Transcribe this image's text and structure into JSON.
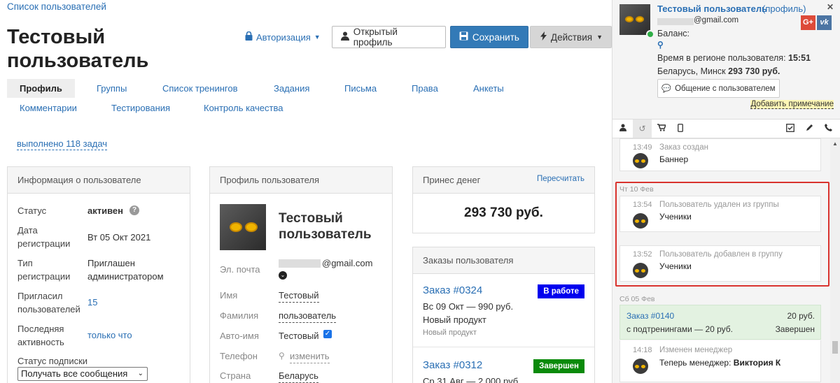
{
  "breadcrumb": "Список пользователей",
  "page_title": "Тестовый пользователь",
  "toolbar": {
    "auth_label": "Авторизация",
    "open_profile_label": "Открытый профиль",
    "save_label": "Сохранить",
    "actions_label": "Действия"
  },
  "tabs": [
    "Профиль",
    "Группы",
    "Список тренингов",
    "Задания",
    "Письма",
    "Права",
    "Анкеты",
    "Комментарии",
    "Тестирования",
    "Контроль качества"
  ],
  "tasks_done": "выполнено 118 задач",
  "info_panel": {
    "title": "Информация о пользователе",
    "status_label": "Статус",
    "status_value": "активен",
    "reg_date_label_1": "Дата",
    "reg_date_label_2": "регистрации",
    "reg_date_value": "Вт 05 Окт 2021",
    "reg_type_label_1": "Тип",
    "reg_type_label_2": "регистрации",
    "reg_type_value_1": "Приглашен",
    "reg_type_value_2": "администратором",
    "invited_label_1": "Пригласил",
    "invited_label_2": "пользователей",
    "invited_value": "15",
    "last_active_label_1": "Последняя",
    "last_active_label_2": "активность",
    "last_active_value": "только что",
    "sub_status_label": "Статус подписки",
    "sub_status_value": "Получать все сообщения"
  },
  "profile_panel": {
    "title": "Профиль пользователя",
    "name_1": "Тестовый",
    "name_2": "пользователь",
    "email_label": "Эл. почта",
    "email_value": "@gmail.com",
    "first_name_label": "Имя",
    "first_name_value": "Тестовый",
    "last_name_label": "Фамилия",
    "last_name_value": "пользователь",
    "auto_name_label": "Авто-имя",
    "auto_name_value": "Тестовый",
    "phone_label": "Телефон",
    "phone_value": "изменить",
    "country_label": "Страна",
    "country_value": "Беларусь"
  },
  "money_panel": {
    "title": "Принес денег",
    "recalc_label": "Пересчитать",
    "amount": "293 730 руб."
  },
  "orders_panel": {
    "title": "Заказы пользователя",
    "orders": [
      {
        "title": "Заказ #0324",
        "line1": "Вс 09 Окт — 990 руб.",
        "line2": "Новый продукт",
        "line3": "Новый продукт",
        "status": "В работе",
        "color": "#0000ee"
      },
      {
        "title": "Заказ #0312",
        "line1": "Ср 31 Авг — 2 000 руб.",
        "status": "Завершен",
        "color": "#0a8a0a"
      }
    ]
  },
  "side": {
    "user_name": "Тестовый пользователь",
    "profile_link": "(профиль)",
    "email": "@gmail.com",
    "balance_label": "Баланс:",
    "time_label": "Время в регионе пользователя:",
    "time_value": "15:51",
    "location": "Беларусь, Минск",
    "location_amount": "293 730 руб.",
    "chat_button": "Общение с пользователем",
    "add_note": "Добавить примечание",
    "close": "✕",
    "gplus": "G+",
    "vk": "vk",
    "events": [
      {
        "time": "13:49",
        "name": "Заказ создан",
        "detail": "Баннер"
      },
      {
        "time": "13:54",
        "name": "Пользователь удален из группы",
        "detail": "Ученики"
      },
      {
        "time": "13:52",
        "name": "Пользователь добавлен в группу",
        "detail": "Ученики"
      },
      {
        "time": "14:18",
        "name": "Изменен менеджер",
        "detail_prefix": "Теперь менеджер:",
        "detail_bold": "Виктория К"
      }
    ],
    "day_1": "Чт 10 Фев",
    "day_2": "Сб 05 Фев",
    "order_card": {
      "title": "Заказ #0140",
      "amount": "20 руб.",
      "subtitle": "с подтренингами — 20 руб.",
      "status": "Завершен"
    }
  }
}
